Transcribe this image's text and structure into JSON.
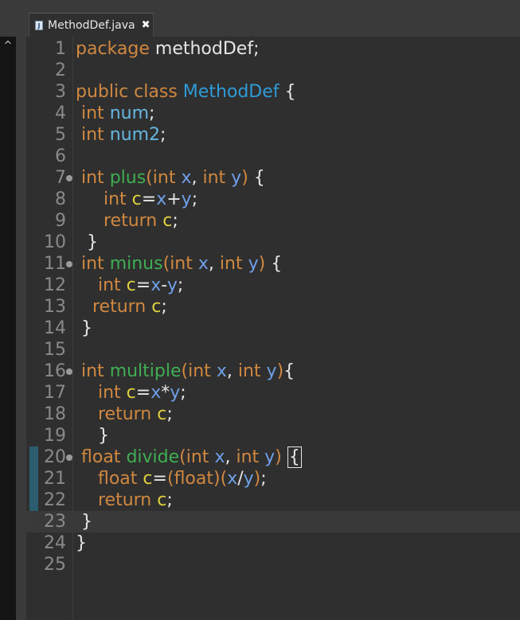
{
  "tab": {
    "label": "MethodDef.java",
    "close_glyph": "✖",
    "icon_glyph": "J"
  },
  "side": {
    "chevron": "^"
  },
  "editor": {
    "lines": [
      {
        "n": "1",
        "tokens": [
          [
            "kw",
            "package"
          ],
          [
            "pn",
            " methodDef;"
          ]
        ]
      },
      {
        "n": "2",
        "tokens": []
      },
      {
        "n": "3",
        "tokens": [
          [
            "kw",
            "public class "
          ],
          [
            "cls",
            "MethodDef"
          ],
          [
            "pn",
            " {"
          ]
        ]
      },
      {
        "n": "4",
        "tokens": [
          [
            "pn",
            " "
          ],
          [
            "kw",
            "int"
          ],
          [
            "pn",
            " "
          ],
          [
            "fld",
            "num"
          ],
          [
            "pn",
            ";"
          ]
        ]
      },
      {
        "n": "5",
        "tokens": [
          [
            "pn",
            " "
          ],
          [
            "kw",
            "int"
          ],
          [
            "pn",
            " "
          ],
          [
            "fld",
            "num2"
          ],
          [
            "pn",
            ";"
          ]
        ]
      },
      {
        "n": "6",
        "tokens": []
      },
      {
        "n": "7",
        "fold": true,
        "tokens": [
          [
            "pn",
            " "
          ],
          [
            "kw",
            "int"
          ],
          [
            "pn",
            " "
          ],
          [
            "fn",
            "plus"
          ],
          [
            "kw",
            "("
          ],
          [
            "kw",
            "int"
          ],
          [
            "pn",
            " "
          ],
          [
            "par",
            "x"
          ],
          [
            "pn",
            ", "
          ],
          [
            "kw",
            "int"
          ],
          [
            "pn",
            " "
          ],
          [
            "par",
            "y"
          ],
          [
            "kw",
            ")"
          ],
          [
            "pn",
            " {"
          ]
        ]
      },
      {
        "n": "8",
        "tokens": [
          [
            "pn",
            "     "
          ],
          [
            "kw",
            "int"
          ],
          [
            "pn",
            " "
          ],
          [
            "loc",
            "c"
          ],
          [
            "pn",
            "="
          ],
          [
            "par",
            "x"
          ],
          [
            "pn",
            "+"
          ],
          [
            "par",
            "y"
          ],
          [
            "pn",
            ";"
          ]
        ]
      },
      {
        "n": "9",
        "tokens": [
          [
            "pn",
            "     "
          ],
          [
            "kw",
            "return"
          ],
          [
            "pn",
            " "
          ],
          [
            "loc",
            "c"
          ],
          [
            "pn",
            ";"
          ]
        ]
      },
      {
        "n": "10",
        "tokens": [
          [
            "pn",
            "  }"
          ]
        ]
      },
      {
        "n": "11",
        "fold": true,
        "tokens": [
          [
            "pn",
            " "
          ],
          [
            "kw",
            "int"
          ],
          [
            "pn",
            " "
          ],
          [
            "fn",
            "minus"
          ],
          [
            "kw",
            "("
          ],
          [
            "kw",
            "int"
          ],
          [
            "pn",
            " "
          ],
          [
            "par",
            "x"
          ],
          [
            "pn",
            ", "
          ],
          [
            "kw",
            "int"
          ],
          [
            "pn",
            " "
          ],
          [
            "par",
            "y"
          ],
          [
            "kw",
            ")"
          ],
          [
            "pn",
            " {"
          ]
        ]
      },
      {
        "n": "12",
        "tokens": [
          [
            "pn",
            "    "
          ],
          [
            "kw",
            "int"
          ],
          [
            "pn",
            " "
          ],
          [
            "loc",
            "c"
          ],
          [
            "pn",
            "="
          ],
          [
            "par",
            "x"
          ],
          [
            "pn",
            "-"
          ],
          [
            "par",
            "y"
          ],
          [
            "pn",
            ";"
          ]
        ]
      },
      {
        "n": "13",
        "tokens": [
          [
            "pn",
            "   "
          ],
          [
            "kw",
            "return"
          ],
          [
            "pn",
            " "
          ],
          [
            "loc",
            "c"
          ],
          [
            "pn",
            ";"
          ]
        ]
      },
      {
        "n": "14",
        "tokens": [
          [
            "pn",
            " }"
          ]
        ]
      },
      {
        "n": "15",
        "tokens": []
      },
      {
        "n": "16",
        "fold": true,
        "tokens": [
          [
            "pn",
            " "
          ],
          [
            "kw",
            "int"
          ],
          [
            "pn",
            " "
          ],
          [
            "fn",
            "multiple"
          ],
          [
            "kw",
            "("
          ],
          [
            "kw",
            "int"
          ],
          [
            "pn",
            " "
          ],
          [
            "par",
            "x"
          ],
          [
            "pn",
            ", "
          ],
          [
            "kw",
            "int"
          ],
          [
            "pn",
            " "
          ],
          [
            "par",
            "y"
          ],
          [
            "kw",
            ")"
          ],
          [
            "pn",
            "{"
          ]
        ]
      },
      {
        "n": "17",
        "tokens": [
          [
            "pn",
            "    "
          ],
          [
            "kw",
            "int"
          ],
          [
            "pn",
            " "
          ],
          [
            "loc",
            "c"
          ],
          [
            "pn",
            "="
          ],
          [
            "par",
            "x"
          ],
          [
            "pn",
            "*"
          ],
          [
            "par",
            "y"
          ],
          [
            "pn",
            ";"
          ]
        ]
      },
      {
        "n": "18",
        "tokens": [
          [
            "pn",
            "    "
          ],
          [
            "kw",
            "return"
          ],
          [
            "pn",
            " "
          ],
          [
            "loc",
            "c"
          ],
          [
            "pn",
            ";"
          ]
        ]
      },
      {
        "n": "19",
        "tokens": [
          [
            "pn",
            "    }"
          ]
        ]
      },
      {
        "n": "20",
        "fold": true,
        "mark": true,
        "tokens": [
          [
            "pn",
            " "
          ],
          [
            "kw",
            "float"
          ],
          [
            "pn",
            " "
          ],
          [
            "fn",
            "divide"
          ],
          [
            "kw",
            "("
          ],
          [
            "kw",
            "int"
          ],
          [
            "pn",
            " "
          ],
          [
            "par",
            "x"
          ],
          [
            "pn",
            ", "
          ],
          [
            "kw",
            "int"
          ],
          [
            "pn",
            " "
          ],
          [
            "par",
            "y"
          ],
          [
            "kw",
            ")"
          ],
          [
            "pn",
            " "
          ],
          [
            "caret",
            "{"
          ]
        ]
      },
      {
        "n": "21",
        "mark": true,
        "tokens": [
          [
            "pn",
            "    "
          ],
          [
            "kw",
            "float"
          ],
          [
            "pn",
            " "
          ],
          [
            "loc",
            "c"
          ],
          [
            "pn",
            "="
          ],
          [
            "kw",
            "("
          ],
          [
            "kw",
            "float"
          ],
          [
            "kw",
            ")"
          ],
          [
            "kw",
            "("
          ],
          [
            "par",
            "x"
          ],
          [
            "pn",
            "/"
          ],
          [
            "par",
            "y"
          ],
          [
            "kw",
            ")"
          ],
          [
            "pn",
            ";"
          ]
        ]
      },
      {
        "n": "22",
        "mark": true,
        "tokens": [
          [
            "pn",
            "    "
          ],
          [
            "kw",
            "return"
          ],
          [
            "pn",
            " "
          ],
          [
            "loc",
            "c"
          ],
          [
            "pn",
            ";"
          ]
        ]
      },
      {
        "n": "23",
        "mark": true,
        "current": true,
        "tokens": [
          [
            "pn",
            " }"
          ]
        ]
      },
      {
        "n": "24",
        "tokens": [
          [
            "pn",
            "}"
          ]
        ]
      },
      {
        "n": "25",
        "tokens": []
      }
    ]
  }
}
